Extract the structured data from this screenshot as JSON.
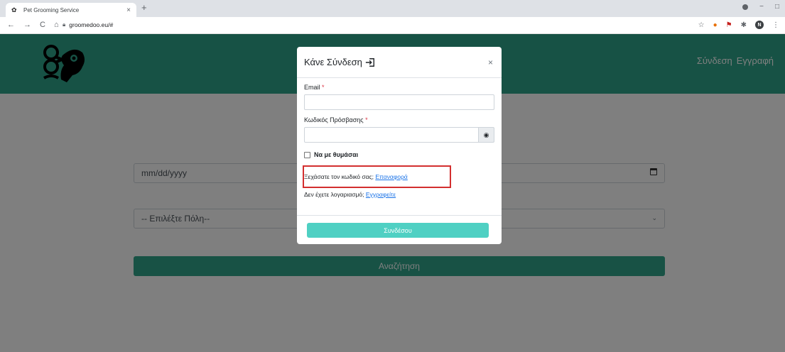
{
  "browser": {
    "tab_title": "Pet Grooming Service",
    "tab_close": "×",
    "new_tab": "+",
    "url": "groomedoo.eu/#",
    "back": "←",
    "forward": "→",
    "reload": "C",
    "home": "⌂",
    "star": "☆",
    "profile_initial": "N",
    "minimize": "−",
    "maximize": "□",
    "more": "⋮"
  },
  "navbar": {
    "login_link": "Σύνδεση",
    "register_link": "Εγγραφή"
  },
  "search_form": {
    "date_placeholder": "mm/dd/yyyy",
    "city_placeholder": "-- Επιλέξτε Πόλη--",
    "search_button": "Αναζήτηση"
  },
  "modal": {
    "title": "Κάνε Σύνδεση",
    "close": "×",
    "email_label": "Email",
    "password_label": "Κωδικός Πρόσβασης",
    "required_mark": "*",
    "remember_label": "Να με θυμάσαι",
    "forgot_text": "Ξεχάσατε τον κωδικό σας;",
    "forgot_link": "Επαναφορά",
    "no_account_text": "Δεν έχετε λογαριασμό;",
    "register_link": "Εγγραφείτε",
    "login_button": "Συνδέσου"
  },
  "colors": {
    "brand_green": "#2fa58b",
    "login_button": "#4fd0c3",
    "highlight_box": "#d32f2f",
    "link": "#1a73e8"
  },
  "icons": [
    "puzzle-favicon",
    "lock-icon",
    "login-icon",
    "eye-icon",
    "calendar-icon",
    "chevron-down-icon",
    "scissors-dog-logo"
  ]
}
